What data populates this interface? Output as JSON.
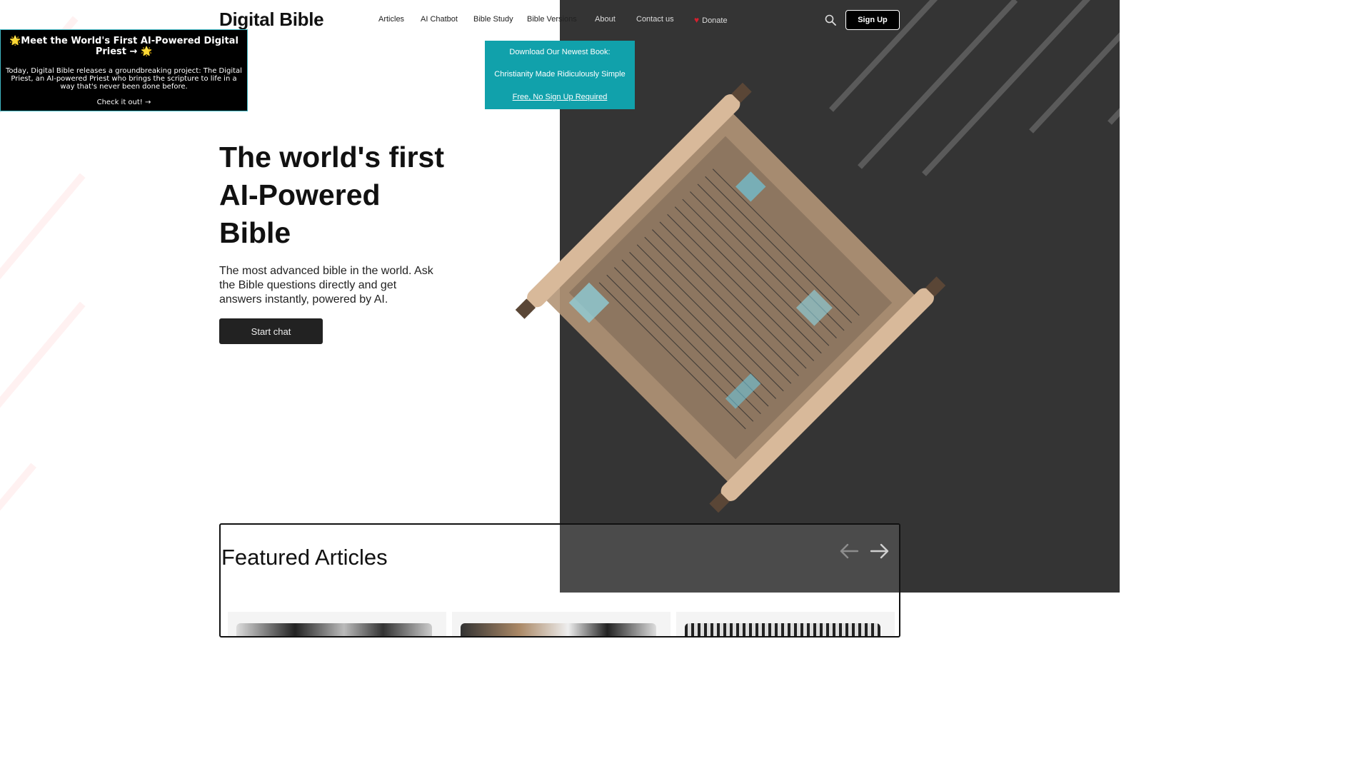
{
  "header": {
    "logo": "Digital Bible",
    "nav": {
      "articles": "Articles",
      "ai_chatbot": "AI Chatbot",
      "bible_study": "Bible Study",
      "bible_versions": "Bible Versions",
      "about": "About",
      "contact": "Contact us",
      "donate": "Donate"
    },
    "signup": "Sign Up"
  },
  "book_dropdown": {
    "line1": "Download Our Newest Book:",
    "line2": "Christianity Made Ridiculously Simple",
    "link": "Free, No Sign Up Required"
  },
  "promo": {
    "heading": "🌟Meet the World's First AI-Powered Digital Priest → 🌟",
    "body": "Today, Digital Bible releases a groundbreaking project: The Digital Priest, an AI-powered Priest who brings the scripture to life in a way that's never been done before.",
    "cta": "Check it out! →"
  },
  "hero": {
    "title": "The world's first AI-Powered Bible",
    "subtitle": "The most advanced bible in the world. Ask the Bible questions directly and get answers instantly, powered by AI.",
    "button": "Start chat"
  },
  "featured": {
    "title": "Featured Articles"
  },
  "colors": {
    "teal": "#11a1ab",
    "dark_panel": "#343434",
    "accent_red": "#d6202e"
  },
  "icons": [
    "search-icon",
    "heart-icon",
    "arrow-left-icon",
    "arrow-right-icon"
  ]
}
